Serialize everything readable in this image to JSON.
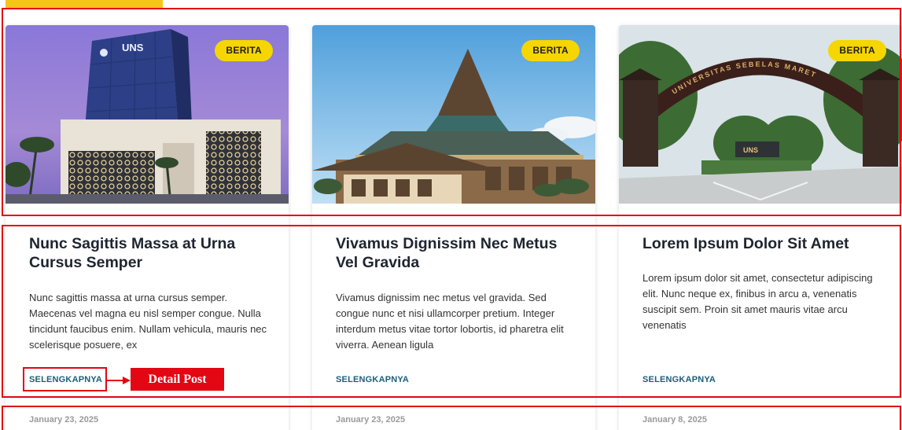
{
  "cards": [
    {
      "badge": "BERITA",
      "title": "Nunc Sagittis Massa at Urna Cursus Semper",
      "excerpt": "Nunc sagittis massa at urna cursus semper. Maecenas vel magna eu nisl semper congue. Nulla tincidunt faucibus enim. Nullam vehicula, mauris nec scelerisque posuere, ex",
      "read_more": "SELENGKAPNYA",
      "date": "January 23, 2025",
      "image_sign": "UNS"
    },
    {
      "badge": "BERITA",
      "title": "Vivamus Dignissim Nec Metus Vel Gravida",
      "excerpt": "Vivamus dignissim nec metus vel gravida. Sed congue nunc et nisi ullamcorper pretium. Integer interdum metus vitae tortor lobortis, id pharetra elit viverra. Aenean ligula",
      "read_more": "SELENGKAPNYA",
      "date": "January 23, 2025"
    },
    {
      "badge": "BERITA",
      "title": "Lorem Ipsum Dolor Sit Amet",
      "excerpt": "Lorem ipsum dolor sit amet, consectetur adipiscing elit. Nunc neque ex, finibus in arcu a, venenatis suscipit sem. Proin sit amet mauris vitae arcu venenatis",
      "read_more": "SELENGKAPNYA",
      "date": "January 8, 2025",
      "gate_text": "UNIVERSITAS SEBELAS MARET",
      "image_sign": "UNS"
    }
  ],
  "annotation": {
    "label": "Detail Post",
    "color": "#e30613"
  },
  "colors": {
    "badge": "#f5d600",
    "link": "#1a5f7a",
    "accent": "#f5c518"
  }
}
